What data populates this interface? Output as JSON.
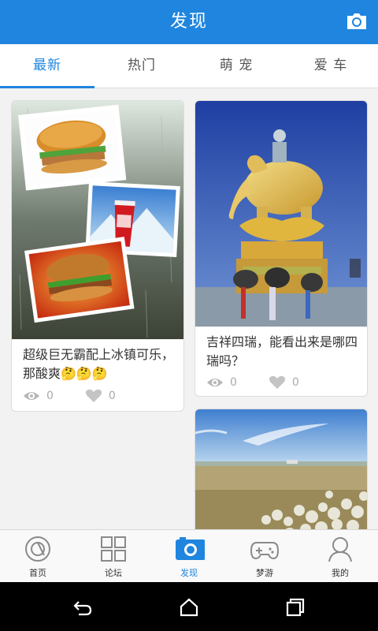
{
  "header": {
    "title": "发现"
  },
  "tabs": [
    {
      "label": "最新",
      "active": true
    },
    {
      "label": "热门",
      "active": false
    },
    {
      "label": "萌 宠",
      "active": false
    },
    {
      "label": "爱 车",
      "active": false
    }
  ],
  "posts": [
    {
      "text": "超级巨无霸配上冰镇可乐，那酸爽🤔🤔🤔",
      "views": "0",
      "likes": "0"
    },
    {
      "text": "吉祥四瑞，能看出来是哪四瑞吗？",
      "views": "0",
      "likes": "0"
    }
  ],
  "bottom_nav": [
    {
      "label": "首页",
      "icon": "home-icon",
      "active": false
    },
    {
      "label": "论坛",
      "icon": "grid-icon",
      "active": false
    },
    {
      "label": "发现",
      "icon": "camera-icon",
      "active": true
    },
    {
      "label": "梦游",
      "icon": "gamepad-icon",
      "active": false
    },
    {
      "label": "我的",
      "icon": "person-icon",
      "active": false
    }
  ],
  "colors": {
    "primary": "#1f85de",
    "background": "#f2f2f2",
    "muted": "#aaaaaa"
  },
  "system_bar": {
    "buttons": [
      "back-icon",
      "home-icon",
      "recents-icon"
    ]
  }
}
